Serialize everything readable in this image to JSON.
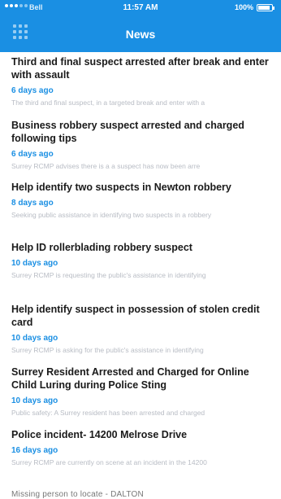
{
  "status": {
    "carrier": "Bell",
    "time": "11:57 AM",
    "battery": "100%",
    "battery_level": 0.8
  },
  "header": {
    "title": "News",
    "menu_icon": "grid-icon"
  },
  "news": [
    {
      "headline": "Third and final suspect arrested after break and enter with assault",
      "age": "6 days ago",
      "snippet": "The third and final suspect, in a targeted break and enter with a"
    },
    {
      "headline": "Business robbery suspect arrested and charged following tips",
      "age": "6 days ago",
      "snippet": "Surrey RCMP advises there is a a suspect has now been arre"
    },
    {
      "headline": "Help identify two suspects in Newton robbery",
      "age": "8 days ago",
      "snippet": "Seeking public assistance in identifying two suspects in a robbery"
    },
    {
      "headline": "Help ID rollerblading robbery suspect",
      "age": "10 days ago",
      "snippet": "Surrey RCMP is requesting the public's assistance in identifying"
    },
    {
      "headline": "Help identify suspect in possession of stolen credit card",
      "age": "10 days ago",
      "snippet": "Surrey RCMP is asking for the public's assistance in identifying"
    },
    {
      "headline": "Surrey Resident Arrested and Charged for Online Child Luring during Police Sting",
      "age": "10 days ago",
      "snippet": "Public safety: A Surrey resident has been arrested and charged"
    },
    {
      "headline": "Police incident- 14200 Melrose Drive",
      "age": "16 days ago",
      "snippet": "Surrey RCMP are currently on scene at an incident in the 14200"
    }
  ],
  "last_partial": "Missing person to locate - DALTON"
}
